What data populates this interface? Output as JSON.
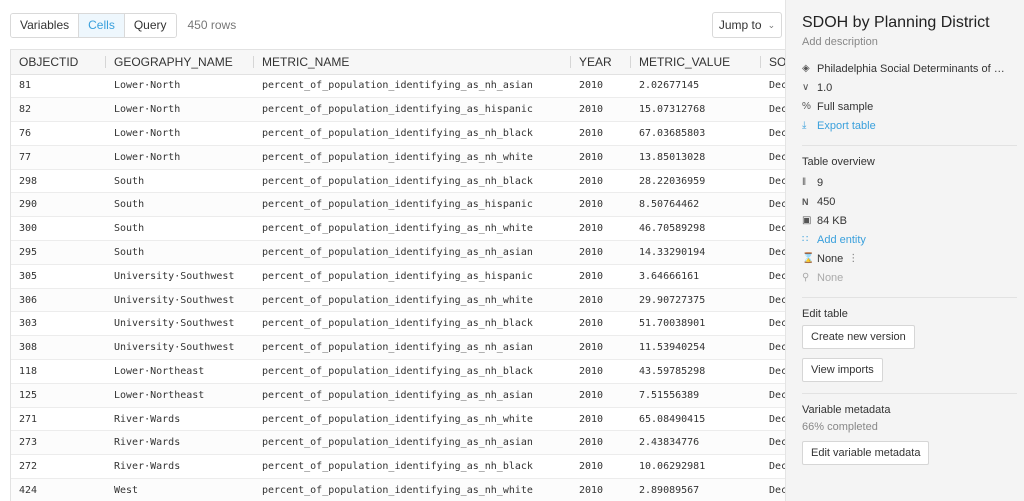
{
  "toolbar": {
    "tabs": [
      "Variables",
      "Cells",
      "Query"
    ],
    "active_tab": "Cells",
    "rows_count": "450 rows",
    "jump_label": "Jump to"
  },
  "table": {
    "columns": [
      "OBJECTID",
      "GEOGRAPHY_NAME",
      "METRIC_NAME",
      "YEAR",
      "METRIC_VALUE",
      "SO"
    ],
    "rows": [
      [
        "81",
        "Lower·North",
        "percent_of_population_identifying_as_nh_asian",
        "2010",
        "2.02677145",
        "Dec"
      ],
      [
        "82",
        "Lower·North",
        "percent_of_population_identifying_as_hispanic",
        "2010",
        "15.07312768",
        "Dec"
      ],
      [
        "76",
        "Lower·North",
        "percent_of_population_identifying_as_nh_black",
        "2010",
        "67.03685803",
        "Dec"
      ],
      [
        "77",
        "Lower·North",
        "percent_of_population_identifying_as_nh_white",
        "2010",
        "13.85013028",
        "Dec"
      ],
      [
        "298",
        "South",
        "percent_of_population_identifying_as_nh_black",
        "2010",
        "28.22036959",
        "Dec"
      ],
      [
        "290",
        "South",
        "percent_of_population_identifying_as_hispanic",
        "2010",
        "8.50764462",
        "Dec"
      ],
      [
        "300",
        "South",
        "percent_of_population_identifying_as_nh_white",
        "2010",
        "46.70589298",
        "Dec"
      ],
      [
        "295",
        "South",
        "percent_of_population_identifying_as_nh_asian",
        "2010",
        "14.33290194",
        "Dec"
      ],
      [
        "305",
        "University·Southwest",
        "percent_of_population_identifying_as_hispanic",
        "2010",
        "3.64666161",
        "Dec"
      ],
      [
        "306",
        "University·Southwest",
        "percent_of_population_identifying_as_nh_white",
        "2010",
        "29.90727375",
        "Dec"
      ],
      [
        "303",
        "University·Southwest",
        "percent_of_population_identifying_as_nh_black",
        "2010",
        "51.70038901",
        "Dec"
      ],
      [
        "308",
        "University·Southwest",
        "percent_of_population_identifying_as_nh_asian",
        "2010",
        "11.53940254",
        "Dec"
      ],
      [
        "118",
        "Lower·Northeast",
        "percent_of_population_identifying_as_nh_black",
        "2010",
        "43.59785298",
        "Dec"
      ],
      [
        "125",
        "Lower·Northeast",
        "percent_of_population_identifying_as_nh_asian",
        "2010",
        "7.51556389",
        "Dec"
      ],
      [
        "271",
        "River·Wards",
        "percent_of_population_identifying_as_nh_white",
        "2010",
        "65.08490415",
        "Dec"
      ],
      [
        "273",
        "River·Wards",
        "percent_of_population_identifying_as_nh_asian",
        "2010",
        "2.43834776",
        "Dec"
      ],
      [
        "272",
        "River·Wards",
        "percent_of_population_identifying_as_nh_black",
        "2010",
        "10.06292981",
        "Dec"
      ],
      [
        "424",
        "West",
        "percent_of_population_identifying_as_nh_white",
        "2010",
        "2.89089567",
        "Dec"
      ]
    ]
  },
  "panel": {
    "title": "SDOH by Planning District",
    "description_placeholder": "Add description",
    "dataset": "Philadelphia Social Determinants of …",
    "version": "1.0",
    "sample": "Full sample",
    "export_label": "Export table",
    "overview_heading": "Table overview",
    "variables": "9",
    "rows": "450",
    "size": "84 KB",
    "add_entity": "Add entity",
    "temporal": "None",
    "geo": "None",
    "edit_heading": "Edit table",
    "create_version": "Create new version",
    "view_imports": "View imports",
    "metadata_heading": "Variable metadata",
    "metadata_progress": "66% completed",
    "edit_metadata": "Edit variable metadata"
  },
  "colors": {
    "accent": "#3aa0dc"
  }
}
